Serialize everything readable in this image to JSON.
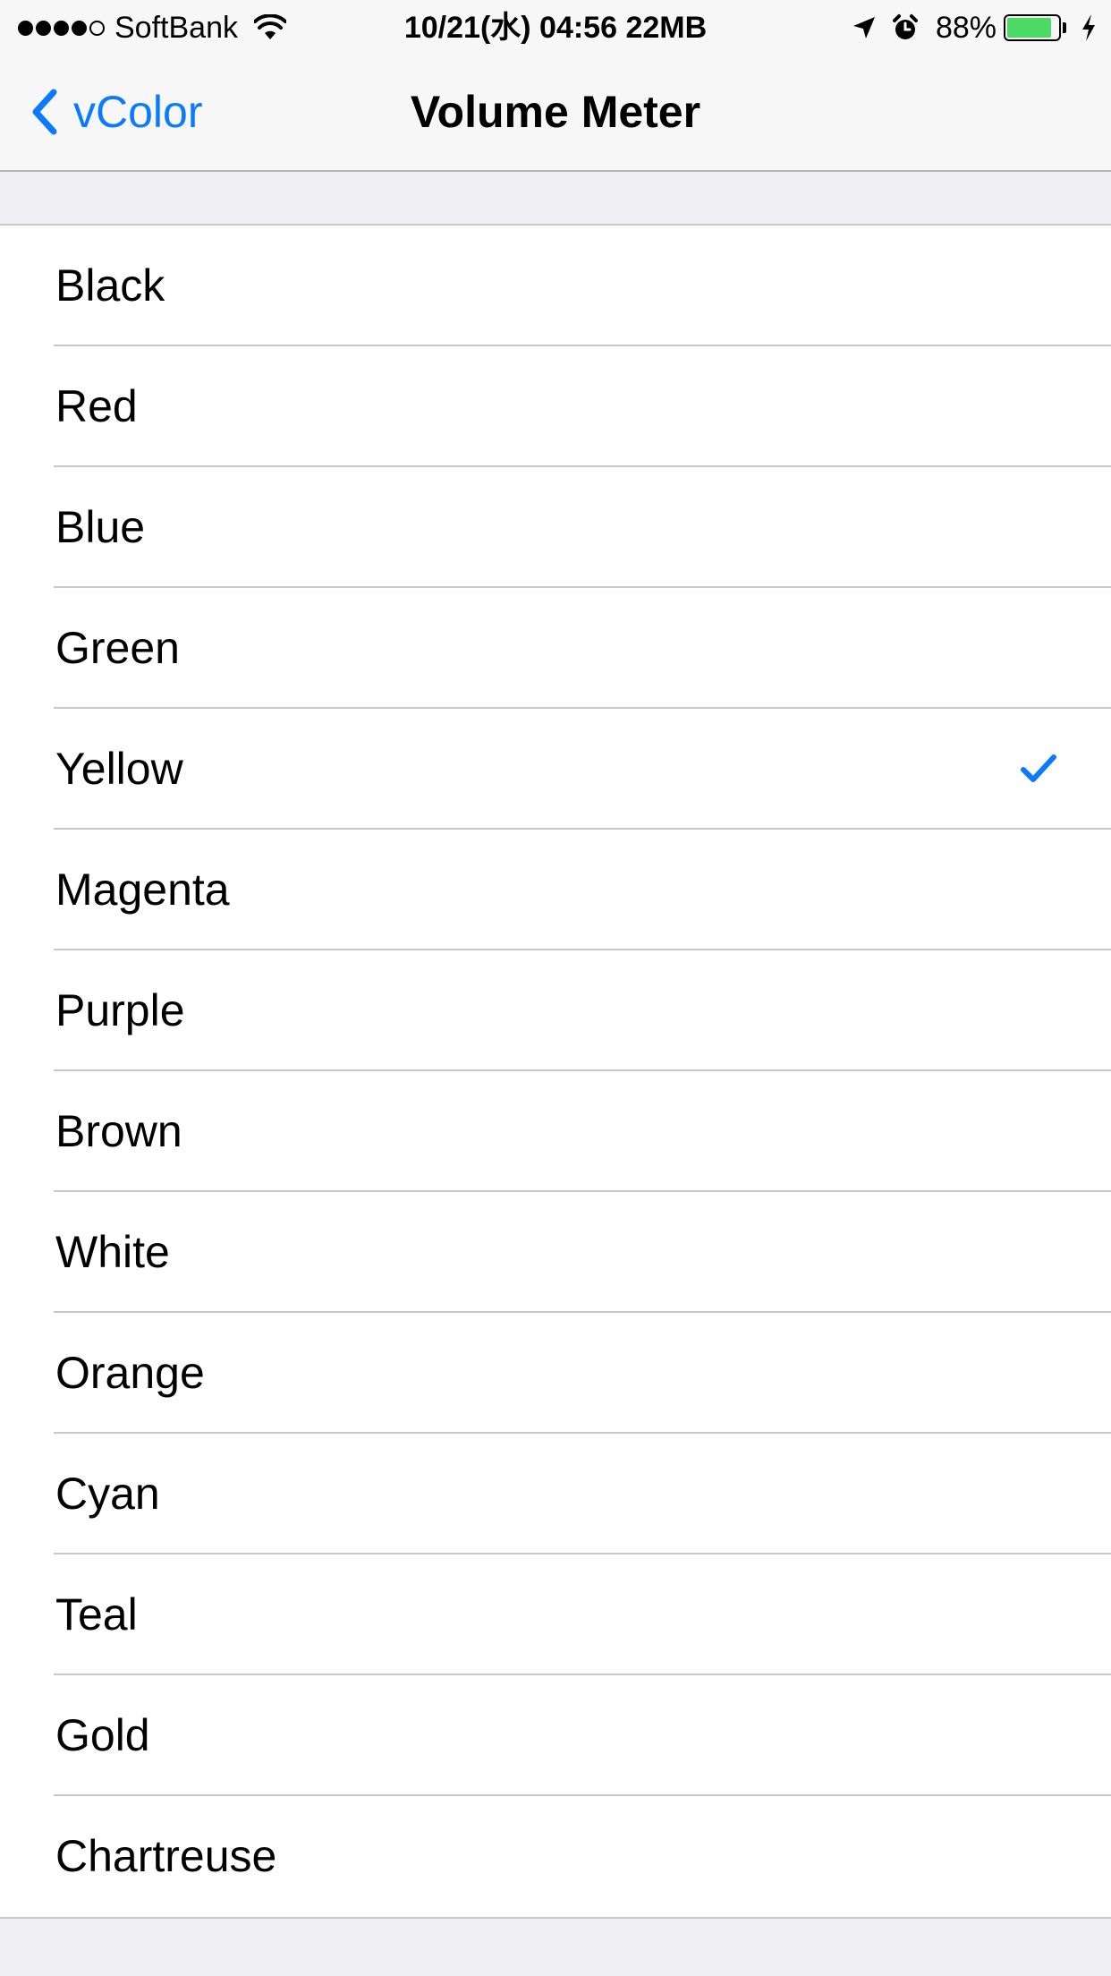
{
  "status_bar": {
    "carrier": "SoftBank",
    "center_text": "10/21(水) 04:56 22MB",
    "battery_percent": "88%",
    "battery_level": 0.88,
    "signal_bars": 4,
    "signal_total": 5,
    "icons": [
      "wifi-icon",
      "location-arrow-icon",
      "alarm-icon",
      "charging-bolt-icon"
    ]
  },
  "nav": {
    "back_label": "vColor",
    "title": "Volume Meter"
  },
  "colors": {
    "accent": "#0a7aff",
    "battery_green": "#4cd964",
    "background": "#efeff4"
  },
  "list": {
    "selected_index": 4,
    "items": [
      {
        "label": "Black"
      },
      {
        "label": "Red"
      },
      {
        "label": "Blue"
      },
      {
        "label": "Green"
      },
      {
        "label": "Yellow"
      },
      {
        "label": "Magenta"
      },
      {
        "label": "Purple"
      },
      {
        "label": "Brown"
      },
      {
        "label": "White"
      },
      {
        "label": "Orange"
      },
      {
        "label": "Cyan"
      },
      {
        "label": "Teal"
      },
      {
        "label": "Gold"
      },
      {
        "label": "Chartreuse"
      }
    ]
  }
}
